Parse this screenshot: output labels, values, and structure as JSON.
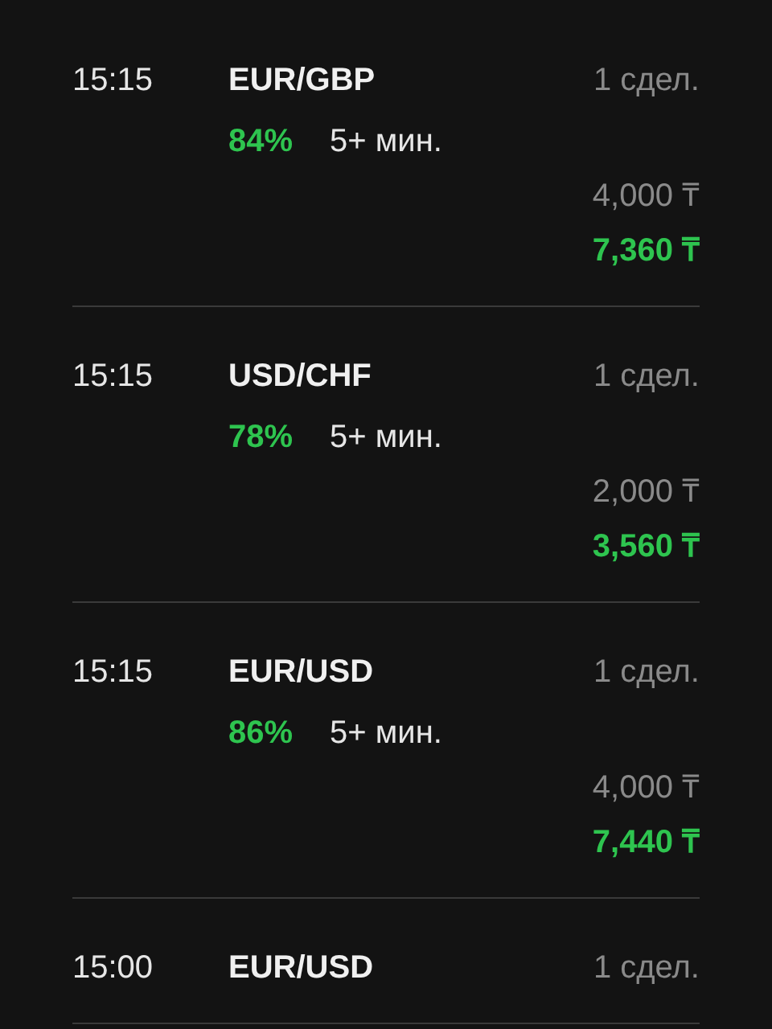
{
  "trades": [
    {
      "time": "15:15",
      "pair": "EUR/GBP",
      "deals": "1 сдел.",
      "payout": "84%",
      "duration": "5+ мин.",
      "amount": "4,000 ₸",
      "profit": "7,360 ₸"
    },
    {
      "time": "15:15",
      "pair": "USD/CHF",
      "deals": "1 сдел.",
      "payout": "78%",
      "duration": "5+ мин.",
      "amount": "2,000 ₸",
      "profit": "3,560 ₸"
    },
    {
      "time": "15:15",
      "pair": "EUR/USD",
      "deals": "1 сдел.",
      "payout": "86%",
      "duration": "5+ мин.",
      "amount": "4,000 ₸",
      "profit": "7,440 ₸"
    },
    {
      "time": "15:00",
      "pair": "EUR/USD",
      "deals": "1 сдел."
    }
  ]
}
